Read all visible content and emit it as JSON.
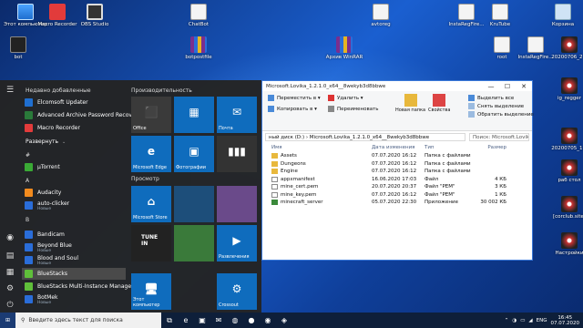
{
  "desktop": {
    "icons": [
      {
        "label": "Этот компьютер",
        "icon": "computer-icon"
      },
      {
        "label": "Macro Recorder",
        "icon": "macro-recorder-icon"
      },
      {
        "label": "OBS Studio",
        "icon": "obs-icon"
      },
      {
        "label": "ChatBot",
        "icon": "file-icon"
      },
      {
        "label": "avtoreg",
        "icon": "file-icon"
      },
      {
        "label": "InstaRegFire...",
        "icon": "file-icon"
      },
      {
        "label": "KruTube",
        "icon": "file-icon"
      },
      {
        "label": "Корзина",
        "icon": "recycle-bin-icon"
      },
      {
        "label": "bot",
        "icon": "dark-app-icon"
      },
      {
        "label": "botpostfile",
        "icon": "winrar-icon"
      },
      {
        "label": "Архив WinRAR",
        "icon": "winrar-icon"
      },
      {
        "label": "root",
        "icon": "file-icon"
      },
      {
        "label": "InstaRegFire...",
        "icon": "file-icon"
      },
      {
        "label": "20200706_2...",
        "icon": "disc-icon"
      },
      {
        "label": "ig_regger",
        "icon": "disc-icon"
      },
      {
        "label": "20200705_1...",
        "icon": "disc-icon"
      },
      {
        "label": "раб стол",
        "icon": "disc-icon"
      },
      {
        "label": "[corclub.site]",
        "icon": "disc-icon"
      },
      {
        "label": "Настройки",
        "icon": "disc-icon"
      }
    ]
  },
  "start_menu": {
    "recent_header": "Недавно добавленные",
    "expand_label": "Развернуть",
    "expand_arrow": "⌄",
    "recent_items": [
      {
        "label": "Elcomsoft Updater",
        "color": "#1f6fd0"
      },
      {
        "label": "Advanced Archive Password Recovery",
        "color": "#2a7a3a"
      },
      {
        "label": "Macro Recorder",
        "color": "#e23b3b"
      }
    ],
    "letters": [
      "#",
      "A",
      "B"
    ],
    "items": [
      {
        "label": "µTorrent",
        "sub": "",
        "color": "#3aaa35"
      },
      {
        "label": "Audacity",
        "sub": "",
        "color": "#f28b1e"
      },
      {
        "label": "auto-clicker",
        "sub": "Новые",
        "color": "#2a6dd9"
      },
      {
        "label": "Bandicam",
        "sub": "",
        "color": "#2a6dd9"
      },
      {
        "label": "Beyond Blue",
        "sub": "Новые",
        "color": "#2a6dd9"
      },
      {
        "label": "Blood and Soul",
        "sub": "Новые",
        "color": "#2a6dd9"
      },
      {
        "label": "BlueStacks",
        "sub": "",
        "color": "#5fbf3a"
      },
      {
        "label": "BlueStacks Multi-Instance Manager",
        "sub": "",
        "color": "#5fbf3a"
      },
      {
        "label": "BotMek",
        "sub": "Новые",
        "color": "#2a6dd9"
      }
    ],
    "tile_groups": [
      "Производительность",
      "Просмотр"
    ],
    "tiles": [
      {
        "label": "Office",
        "icon": "office-icon",
        "glyph": "⬛",
        "color": "#3a3a3a"
      },
      {
        "label": "",
        "icon": "office-apps-icon",
        "glyph": "▦",
        "color": "#0f6cbd"
      },
      {
        "label": "Почта",
        "icon": "mail-icon",
        "glyph": "✉",
        "color": "#0f6cbd"
      },
      {
        "label": "Microsoft Edge",
        "icon": "edge-icon",
        "glyph": "e",
        "color": "#0f6cbd"
      },
      {
        "label": "Фотографии",
        "icon": "photos-icon",
        "glyph": "▣",
        "color": "#0f6cbd"
      },
      {
        "label": "",
        "icon": "equalizer-icon",
        "glyph": "▮▮▮",
        "color": "#333"
      },
      {
        "label": "Microsoft Store",
        "icon": "store-icon",
        "glyph": "⌂",
        "color": "#0f6cbd"
      },
      {
        "label": "",
        "icon": "disney-icon",
        "glyph": "",
        "color": "#1d4e7a"
      },
      {
        "label": "",
        "icon": "game-icon",
        "glyph": "",
        "color": "#6a4a8a"
      },
      {
        "label": "",
        "icon": "tunein-icon",
        "glyph": "TUNE IN",
        "color": "#222"
      },
      {
        "label": "",
        "icon": "gardenscapes-icon",
        "glyph": "",
        "color": "#3a7a3a"
      },
      {
        "label": "Развлечения",
        "icon": "entertainment-icon",
        "glyph": "▶",
        "color": "#0f6cbd"
      },
      {
        "label": "Этот компьютер",
        "icon": "computer-icon",
        "glyph": "🖥",
        "color": "#0f6cbd"
      },
      {
        "label": "Crossout",
        "icon": "crossout-icon",
        "glyph": "⚙",
        "color": "#0f6cbd"
      }
    ],
    "rail_icons": [
      "☰",
      "◉",
      "▤",
      "▦",
      "⚙",
      "⏻"
    ]
  },
  "explorer": {
    "title": "Microsoft.Lovika_1.2.1.0_x64__8wekyb3d8bbwe",
    "min": "—",
    "max": "☐",
    "close": "✕",
    "ribbon": {
      "move_to": "Переместить в ▾",
      "copy_to": "Копировать в ▾",
      "delete": "Удалить ▾",
      "rename": "Переименовать",
      "new_folder": "Новая папка",
      "properties": "Свойства",
      "select_all": "Выделить все",
      "select_none": "Снять выделение",
      "invert": "Обратить выделение"
    },
    "address": "ный диск (D:)  ›  Microsoft.Lovika_1.2.1.0_x64__8wekyb3d8bbwe",
    "search": "Поиск: Microsoft.Lovika_1.2.1...",
    "columns": [
      "Имя",
      "Дата изменения",
      "Тип",
      "Размер"
    ],
    "files": [
      {
        "name": "Assets",
        "date": "07.07.2020 16:12",
        "type": "Папка с файлами",
        "size": "",
        "kind": "folder"
      },
      {
        "name": "Dungeons",
        "date": "07.07.2020 16:12",
        "type": "Папка с файлами",
        "size": "",
        "kind": "folder"
      },
      {
        "name": "Engine",
        "date": "07.07.2020 16:12",
        "type": "Папка с файлами",
        "size": "",
        "kind": "folder"
      },
      {
        "name": "appxmanifest",
        "date": "16.06.2020 17:03",
        "type": "Файл",
        "size": "4 КБ",
        "kind": "file"
      },
      {
        "name": "mine_cert.pem",
        "date": "20.07.2020 20:37",
        "type": "Файл \"PEM\"",
        "size": "3 КБ",
        "kind": "file"
      },
      {
        "name": "mine_key.pem",
        "date": "07.07.2020 16:12",
        "type": "Файл \"PEM\"",
        "size": "1 КБ",
        "kind": "file"
      },
      {
        "name": "minecraft_server",
        "date": "05.07.2020 22:30",
        "type": "Приложение",
        "size": "30 002 КБ",
        "kind": "exe"
      }
    ]
  },
  "taskbar": {
    "search_placeholder": "Введите здесь текст для поиска",
    "search_glyph": "⚲",
    "win_glyph": "⊞",
    "apps": [
      "⧉",
      "e",
      "▣",
      "✉",
      "◍",
      "●",
      "◉",
      "◈"
    ],
    "tray_up": "⌃",
    "tray_icons": [
      "◑",
      "▭",
      "◢"
    ],
    "lang": "ENG",
    "time": "16:45",
    "date": "07.07.2020"
  }
}
